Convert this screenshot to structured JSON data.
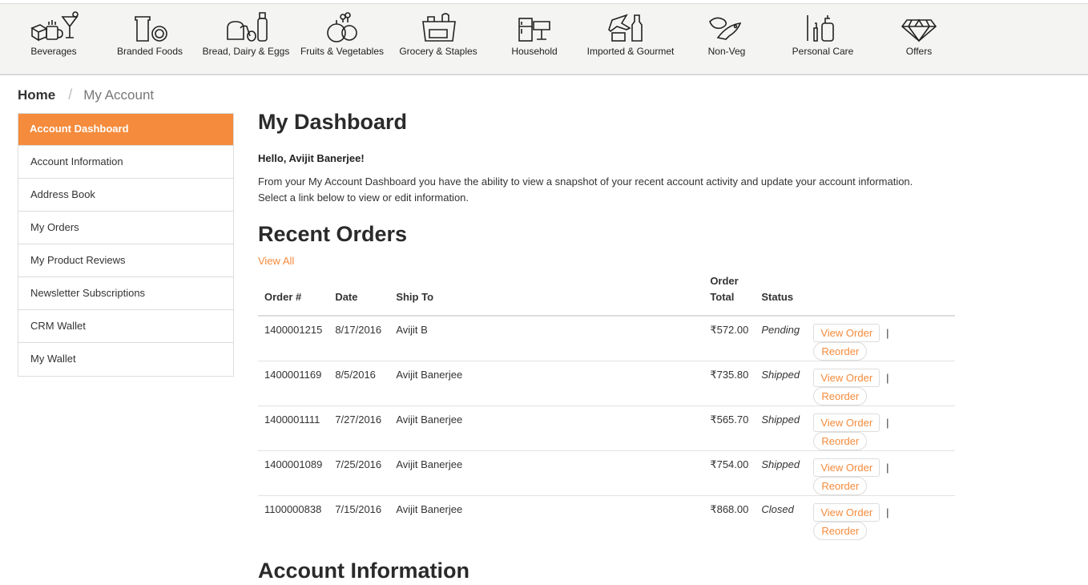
{
  "categories": [
    {
      "label": "Beverages",
      "icon": "beverages-icon"
    },
    {
      "label": "Branded Foods",
      "icon": "branded-foods-icon"
    },
    {
      "label": "Bread, Dairy & Eggs",
      "icon": "bread-dairy-icon"
    },
    {
      "label": "Fruits & Vegetables",
      "icon": "fruits-vegetables-icon"
    },
    {
      "label": "Grocery & Staples",
      "icon": "grocery-icon"
    },
    {
      "label": "Household",
      "icon": "household-icon"
    },
    {
      "label": "Imported & Gourmet",
      "icon": "imported-gourmet-icon"
    },
    {
      "label": "Non-Veg",
      "icon": "non-veg-icon"
    },
    {
      "label": "Personal Care",
      "icon": "personal-care-icon"
    },
    {
      "label": "Offers",
      "icon": "diamond-icon"
    }
  ],
  "breadcrumb": {
    "home": "Home",
    "separator": "/",
    "current": "My Account"
  },
  "sidebar": {
    "items": [
      {
        "label": "Account Dashboard",
        "active": true
      },
      {
        "label": "Account Information"
      },
      {
        "label": "Address Book"
      },
      {
        "label": "My Orders"
      },
      {
        "label": "My Product Reviews"
      },
      {
        "label": "Newsletter Subscriptions"
      },
      {
        "label": "CRM Wallet"
      },
      {
        "label": "My Wallet"
      }
    ]
  },
  "main": {
    "title": "My Dashboard",
    "hello": "Hello, Avijit Banerjee!",
    "intro_line1": "From your My Account Dashboard you have the ability to view a snapshot of your recent account activity and update your account information.",
    "intro_line2": "Select a link below to view or edit information.",
    "recent_title": "Recent Orders",
    "view_all": "View All",
    "columns": {
      "order": "Order #",
      "date": "Date",
      "ship_to": "Ship To",
      "total_line1": "Order",
      "total_line2": "Total",
      "status": "Status"
    },
    "orders": [
      {
        "id": "1400001215",
        "date": "8/17/2016",
        "ship_to": "Avijit B",
        "total": "₹572.00",
        "status": "Pending"
      },
      {
        "id": "1400001169",
        "date": "8/5/2016",
        "ship_to": "Avijit Banerjee",
        "total": "₹735.80",
        "status": "Shipped"
      },
      {
        "id": "1400001111",
        "date": "7/27/2016",
        "ship_to": "Avijit Banerjee",
        "total": "₹565.70",
        "status": "Shipped"
      },
      {
        "id": "1400001089",
        "date": "7/25/2016",
        "ship_to": "Avijit Banerjee",
        "total": "₹754.00",
        "status": "Shipped"
      },
      {
        "id": "1100000838",
        "date": "7/15/2016",
        "ship_to": "Avijit Banerjee",
        "total": "₹868.00",
        "status": "Closed"
      }
    ],
    "view_order_label": "View Order",
    "reorder_label": "Reorder",
    "pipe": "|",
    "account_info_title": "Account Information"
  },
  "colors": {
    "accent": "#f58b3c",
    "nav_bg": "#f4f4f2"
  }
}
